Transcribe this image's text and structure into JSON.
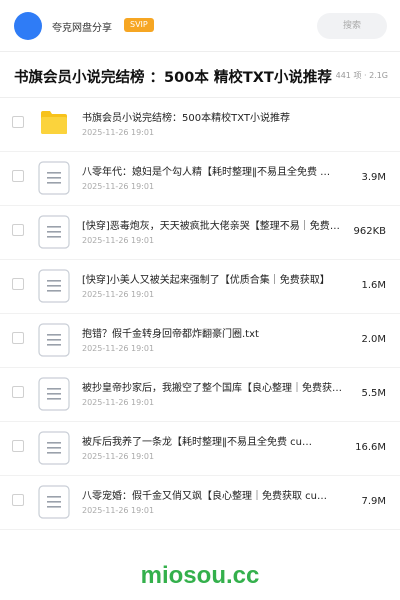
{
  "header": {
    "username": "夸克网盘分享",
    "badge": "SVIP",
    "search_placeholder": "搜索"
  },
  "folder": {
    "title": "书旗会员小说完结榜 ：500本 精校TXT小说推荐",
    "meta": "441 项 · 2.1G"
  },
  "files": [
    {
      "type": "folder",
      "name": "书旗会员小说完结榜：500本精校TXT小说推荐",
      "date": "2025-11-26 19:01",
      "size": ""
    },
    {
      "type": "doc",
      "name": "八零年代：媳妇是个勾人精【耗时整理‖不易且全免费 …",
      "date": "2025-11-26 19:01",
      "size": "3.9M"
    },
    {
      "type": "doc",
      "name": "[快穿]恶毒炮灰，天天被疯批大佬亲哭【整理不易｜免费获取】",
      "date": "2025-11-26 19:01",
      "size": "962KB"
    },
    {
      "type": "doc",
      "name": "[快穿]小美人又被关起来强制了【优质合集｜免费获取】",
      "date": "2025-11-26 19:01",
      "size": "1.6M"
    },
    {
      "type": "doc",
      "name": "抱错？假千金转身回帝都炸翻豪门圈.txt",
      "date": "2025-11-26 19:01",
      "size": "2.0M"
    },
    {
      "type": "doc",
      "name": "被抄皇帝抄家后，我搬空了整个国库【良心整理｜免费获取】",
      "date": "2025-11-26 19:01",
      "size": "5.5M"
    },
    {
      "type": "doc",
      "name": "被斥后我养了一条龙【耗时整理‖不易且全免费 cu…",
      "date": "2025-11-26 19:01",
      "size": "16.6M"
    },
    {
      "type": "doc",
      "name": "八零宠婚：假千金又俏又飒【良心整理｜免费获取 cu…",
      "date": "2025-11-26 19:01",
      "size": "7.9M"
    }
  ],
  "watermark": "miosou.cc",
  "colors": {
    "avatar": "#2f7cf6",
    "badge": "#f6a623",
    "folder_icon": "#f7c21b",
    "doc_icon_border": "#c9ced6",
    "watermark": "#34b04c"
  }
}
